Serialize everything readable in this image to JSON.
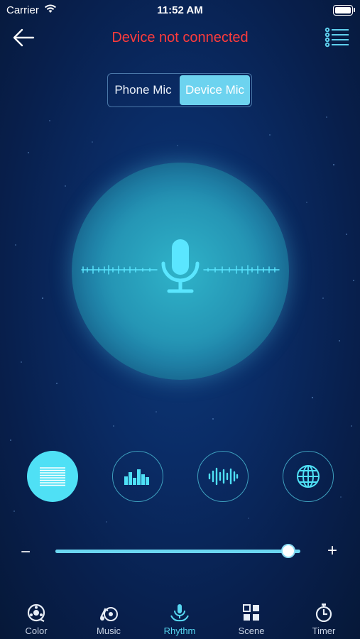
{
  "status_bar": {
    "carrier": "Carrier",
    "time": "11:52 AM"
  },
  "header": {
    "title": "Device not connected",
    "title_color": "#ff3b3b"
  },
  "segmented": {
    "options": [
      "Phone Mic",
      "Device Mic"
    ],
    "selected": "Device Mic"
  },
  "modes": [
    {
      "icon": "horizontal-lines-icon",
      "active": true
    },
    {
      "icon": "equalizer-bars-icon",
      "active": false
    },
    {
      "icon": "sound-wave-icon",
      "active": false
    },
    {
      "icon": "globe-icon",
      "active": false
    }
  ],
  "slider": {
    "minus": "−",
    "plus": "+",
    "value": 0.95
  },
  "tabs": [
    {
      "label": "Color",
      "icon": "color-wheel-icon",
      "active": false
    },
    {
      "label": "Music",
      "icon": "music-note-icon",
      "active": false
    },
    {
      "label": "Rhythm",
      "icon": "microphone-icon",
      "active": true
    },
    {
      "label": "Scene",
      "icon": "grid-icon",
      "active": false
    },
    {
      "label": "Timer",
      "icon": "stopwatch-icon",
      "active": false
    }
  ],
  "colors": {
    "accent": "#4fe0f5",
    "active_tab": "#57d7f1",
    "background": "#0a2c66"
  }
}
